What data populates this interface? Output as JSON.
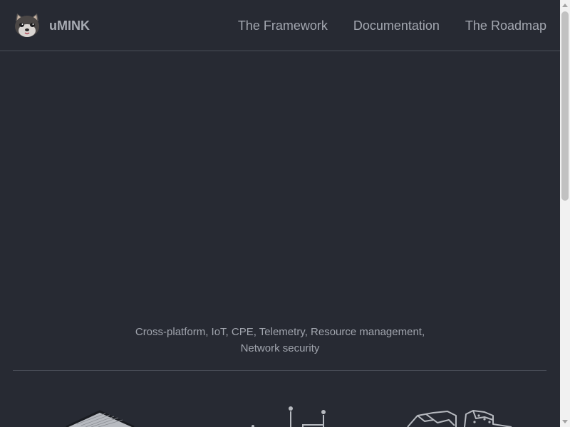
{
  "navbar": {
    "brand_name": "uMINK",
    "links": [
      {
        "label": "The Framework"
      },
      {
        "label": "Documentation"
      },
      {
        "label": "The Roadmap"
      }
    ]
  },
  "hero": {
    "tagline_line1": "Cross-platform, IoT, CPE, Telemetry, Resource management,",
    "tagline_line2": "Network security"
  },
  "icons": {
    "logo": "mink-logo-icon",
    "illustrations": [
      "server-box-icon",
      "circuit-board-icon",
      "rocks-icon"
    ]
  },
  "colors": {
    "background": "#272a33",
    "text": "#a3a7b0",
    "divider": "#4a4e58"
  }
}
